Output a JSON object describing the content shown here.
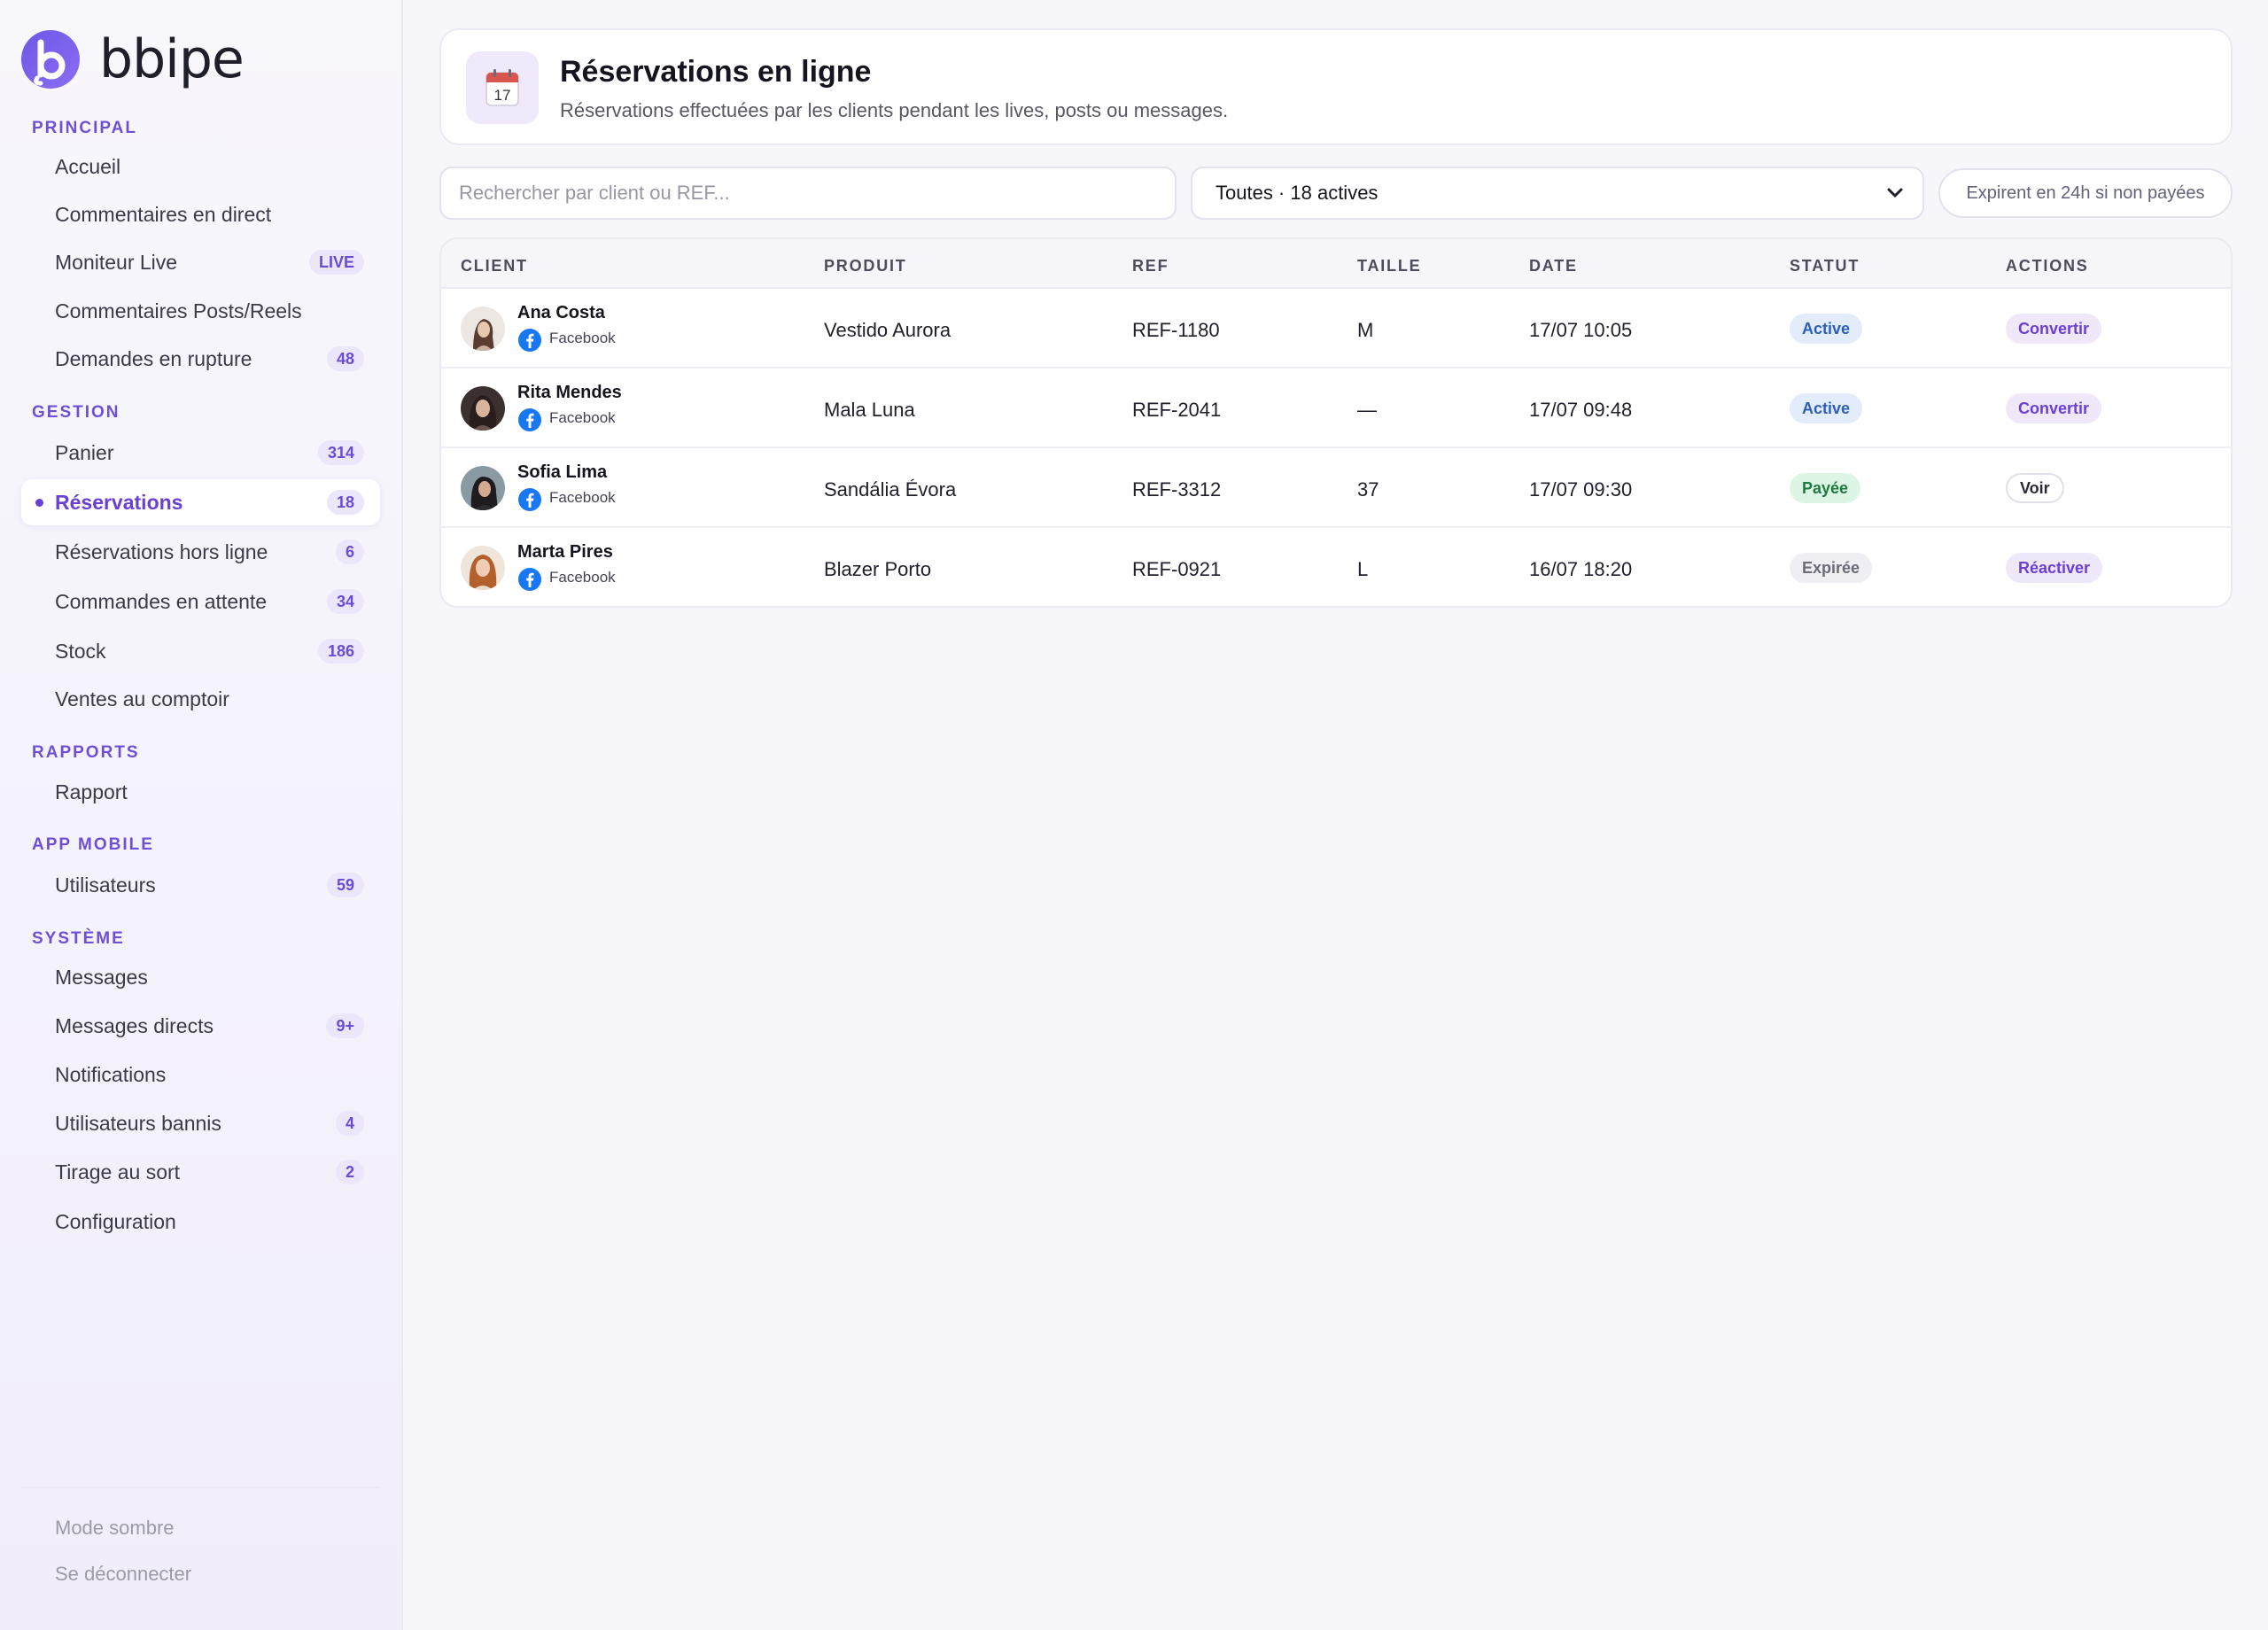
{
  "brand": {
    "name": "bbipe",
    "accent": "#6e58e8"
  },
  "sidebar": {
    "sections": [
      {
        "title": "PRINCIPAL",
        "items": [
          {
            "label": "Accueil",
            "badge": ""
          },
          {
            "label": "Commentaires en direct",
            "badge": ""
          },
          {
            "label": "Moniteur Live",
            "badge": "LIVE"
          },
          {
            "label": "Commentaires Posts/Reels",
            "badge": ""
          },
          {
            "label": "Demandes en rupture",
            "badge": "48"
          }
        ]
      },
      {
        "title": "GESTION",
        "items": [
          {
            "label": "Panier",
            "badge": "314"
          },
          {
            "label": "Réservations",
            "badge": "18",
            "active": true
          },
          {
            "label": "Réservations hors ligne",
            "badge": "6"
          },
          {
            "label": "Commandes en attente",
            "badge": "34"
          },
          {
            "label": "Stock",
            "badge": "186"
          },
          {
            "label": "Ventes au comptoir",
            "badge": ""
          }
        ]
      },
      {
        "title": "RAPPORTS",
        "items": [
          {
            "label": "Rapport",
            "badge": ""
          }
        ]
      },
      {
        "title": "APP MOBILE",
        "items": [
          {
            "label": "Utilisateurs",
            "badge": "59"
          }
        ]
      },
      {
        "title": "SYSTÈME",
        "items": [
          {
            "label": "Messages",
            "badge": ""
          },
          {
            "label": "Messages directs",
            "badge": "9+"
          },
          {
            "label": "Notifications",
            "badge": ""
          },
          {
            "label": "Utilisateurs bannis",
            "badge": "4"
          },
          {
            "label": "Tirage au sort",
            "badge": "2"
          },
          {
            "label": "Configuration",
            "badge": ""
          }
        ]
      }
    ],
    "footer": {
      "dark_mode": "Mode sombre",
      "logout": "Se déconnecter"
    }
  },
  "header": {
    "icon": "calendar-icon",
    "icon_day": "17",
    "title": "Réservations en ligne",
    "subtitle": "Réservations effectuées par les clients pendant les lives, posts ou messages."
  },
  "toolbar": {
    "search_placeholder": "Rechercher par client ou REF...",
    "filter_value": "Toutes · 18 actives",
    "expire_note": "Expirent en 24h si non payées"
  },
  "table": {
    "columns": [
      "CLIENT",
      "PRODUIT",
      "REF",
      "TAILLE",
      "DATE",
      "STATUT",
      "ACTIONS"
    ],
    "rows": [
      {
        "client": "Ana Costa",
        "source": "Facebook",
        "product": "Vestido Aurora",
        "ref": "REF-1180",
        "size": "M",
        "date": "17/07 10:05",
        "status": "Active",
        "action": "Convertir"
      },
      {
        "client": "Rita Mendes",
        "source": "Facebook",
        "product": "Mala Luna",
        "ref": "REF-2041",
        "size": "—",
        "date": "17/07 09:48",
        "status": "Active",
        "action": "Convertir"
      },
      {
        "client": "Sofia Lima",
        "source": "Facebook",
        "product": "Sandália Évora",
        "ref": "REF-3312",
        "size": "37",
        "date": "17/07 09:30",
        "status": "Payée",
        "action": "Voir"
      },
      {
        "client": "Marta Pires",
        "source": "Facebook",
        "product": "Blazer Porto",
        "ref": "REF-0921",
        "size": "L",
        "date": "16/07 18:20",
        "status": "Expirée",
        "action": "Réactiver"
      }
    ]
  }
}
